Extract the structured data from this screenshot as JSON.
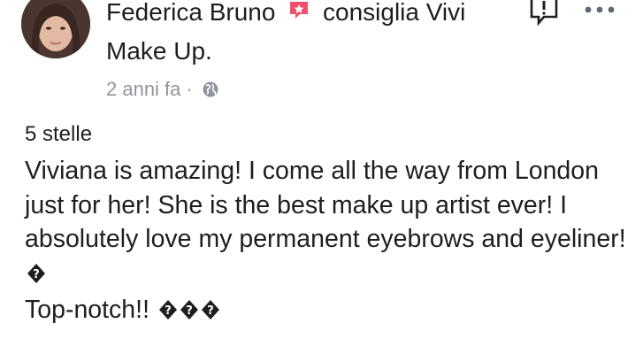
{
  "post": {
    "author": "Federica Bruno",
    "action": "consiglia Vivi",
    "action_cont": "Make Up.",
    "time": "2 anni fa",
    "separator": "·",
    "rating": "5 stelle",
    "paragraph1": "Viviana is amazing! I come all the way from London just for her! She is the best make up artist ever! I absolutely love my permanent eyebrows and eyeliner!",
    "paragraph2": "Top-notch!!"
  },
  "colors": {
    "text": "#1c1e21",
    "meta": "#90949c",
    "recommend_badge": "#f0506e"
  },
  "icons": {
    "recommend": "recommend-badge-icon",
    "privacy": "globe-icon",
    "report": "report-icon",
    "more": "more-options-icon",
    "emoji": "missing-emoji-glyph-icon"
  }
}
